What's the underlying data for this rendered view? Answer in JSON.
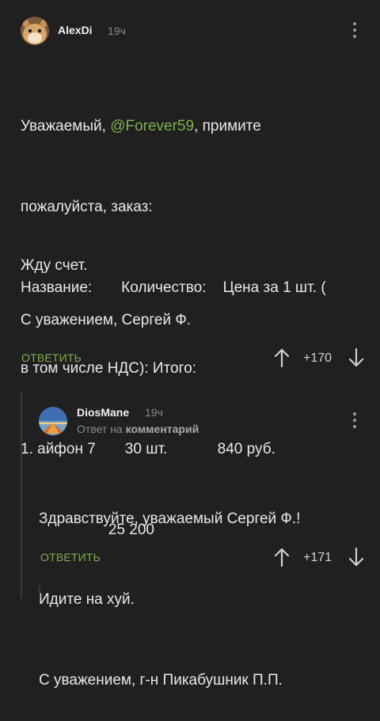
{
  "comment1": {
    "username": "AlexDi",
    "time": "19ч",
    "lines": [
      {
        "pre": "Уважаемый, ",
        "mention": "@Forever59",
        "post": ", примите"
      },
      {
        "text": "пожалуйста, заказ:"
      },
      {
        "text": "Название:       Количество:    Цена за 1 шт. ("
      },
      {
        "text": "в том числе НДС): Итого:"
      },
      {
        "text": "1. айфон 7       30 шт.            840 руб."
      },
      {
        "text": "                     25 200"
      }
    ],
    "waiting": "Жду счет.",
    "signature": "С уважением, Сергей Ф.",
    "reply_label": "ОТВЕТИТЬ",
    "vote_count": "+170"
  },
  "comment2": {
    "username": "DiosMane",
    "time": "19ч",
    "meta_prefix": "Ответ на",
    "meta_link": "комментарий",
    "lines": [
      "Здравствуйте, уважаемый Сергей Ф.!",
      "Идите на хуй.",
      "С уважением, г-н Пикабушник П.П."
    ],
    "reply_label": "ОТВЕТИТЬ",
    "vote_count": "+171"
  },
  "colors": {
    "background": "#202020",
    "mention": "#7fae4a",
    "reply": "#7fae4a"
  },
  "icons": [
    "menu-icon",
    "upvote-icon",
    "downvote-icon"
  ]
}
